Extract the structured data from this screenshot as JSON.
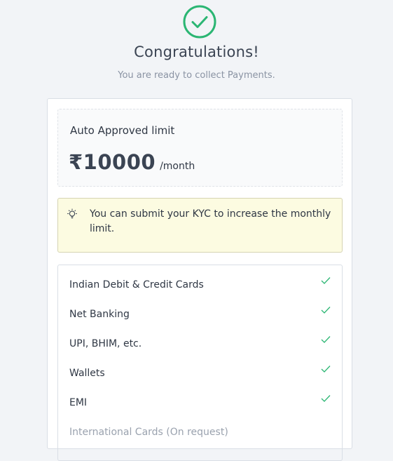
{
  "header": {
    "title": "Congratulations!",
    "subtitle": "You are ready to collect Payments."
  },
  "limit": {
    "label": "Auto Approved limit",
    "amount": "₹10000",
    "unit": "/month"
  },
  "kyc_notice": {
    "text": "You can submit your KYC to increase the monthly limit."
  },
  "payment_methods": [
    {
      "label": "Indian Debit & Credit Cards",
      "enabled": true
    },
    {
      "label": "Net Banking",
      "enabled": true
    },
    {
      "label": "UPI, BHIM, etc.",
      "enabled": true
    },
    {
      "label": "Wallets",
      "enabled": true
    },
    {
      "label": "EMI",
      "enabled": true
    },
    {
      "label": "International Cards (On request)",
      "enabled": false
    }
  ],
  "colors": {
    "success": "#2bb673",
    "notice_bg": "#fcfbe1",
    "page_bg": "#f2f4f7"
  },
  "icons": {
    "header": "check-circle-icon",
    "notice": "lightbulb-icon",
    "method": "check-icon"
  }
}
